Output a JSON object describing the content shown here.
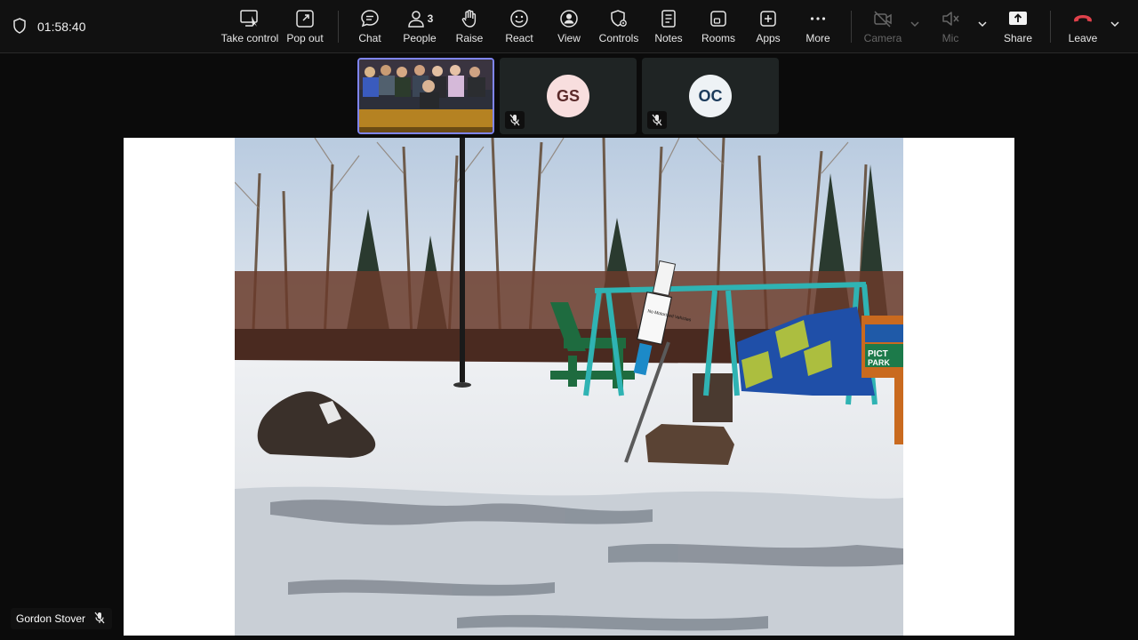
{
  "meeting": {
    "timer": "01:58:40"
  },
  "toolbar": {
    "take_control": "Take control",
    "pop_out": "Pop out",
    "chat": "Chat",
    "people": "People",
    "people_count": "3",
    "raise": "Raise",
    "react": "React",
    "view": "View",
    "controls": "Controls",
    "notes": "Notes",
    "rooms": "Rooms",
    "apps": "Apps",
    "more": "More",
    "camera": "Camera",
    "mic": "Mic",
    "share": "Share",
    "leave": "Leave"
  },
  "participants": [
    {
      "type": "video",
      "name": "room-feed"
    },
    {
      "initials": "GS",
      "muted": true,
      "avatar_bg": "#f8dede",
      "avatar_fg": "#5a2a2a"
    },
    {
      "initials": "OC",
      "muted": true,
      "avatar_bg": "#eef2f5",
      "avatar_fg": "#1b3a5a"
    }
  ],
  "presenter": {
    "name": "Gordon Stover",
    "muted": true
  },
  "shared_content": {
    "signs": [
      "No Motorized Vehicles",
      "PICT",
      "PARK"
    ]
  },
  "colors": {
    "accent": "#7f85f5",
    "leave": "#e0414b",
    "toolbar_bg": "#111111"
  }
}
